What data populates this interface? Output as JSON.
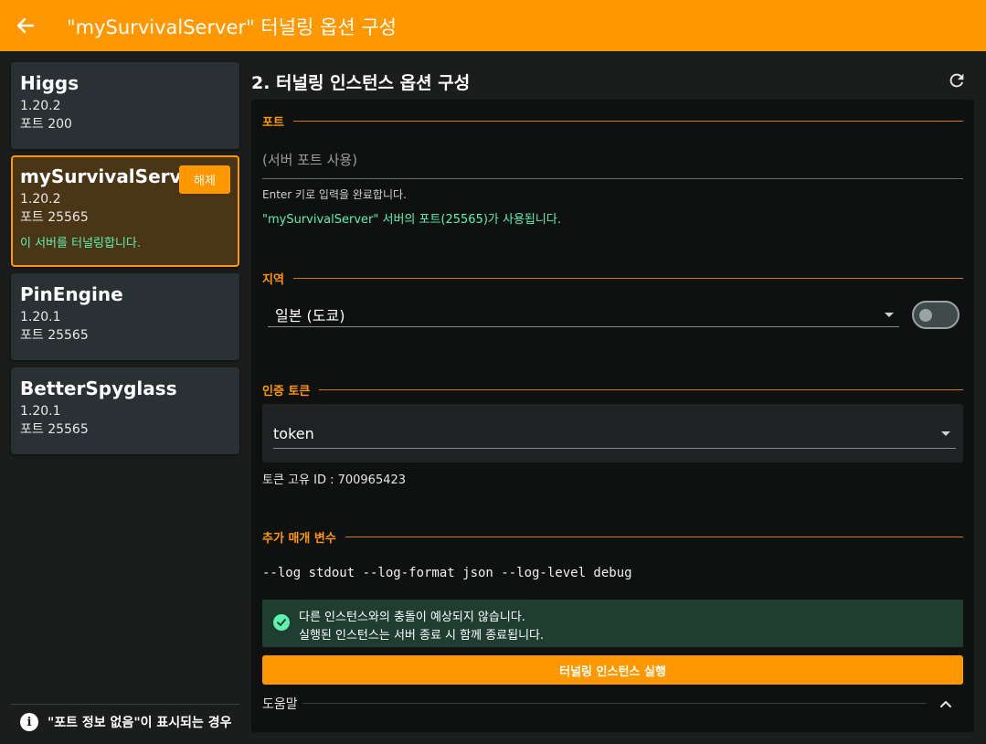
{
  "header": {
    "title": "\"mySurvivalServer\" 터널링 옵션 구성"
  },
  "servers": [
    {
      "name": "Higgs",
      "version": "1.20.2",
      "port": "포트 200"
    },
    {
      "name": "mySurvivalServer",
      "version": "1.20.2",
      "port": "포트 25565",
      "unlink_label": "해제",
      "note": "이 서버를 터널링합니다."
    },
    {
      "name": "PinEngine",
      "version": "1.20.1",
      "port": "포트 25565"
    },
    {
      "name": "BetterSpyglass",
      "version": "1.20.1",
      "port": "포트 25565"
    }
  ],
  "sidebar_help": "\"포트 정보 없음\"이 표시되는 경우",
  "main": {
    "title": "2. 터널링 인스턴스 옵션 구성",
    "port_section": {
      "label": "포트",
      "placeholder": "(서버 포트 사용)",
      "hint": "Enter 키로 입력을 완료합니다.",
      "success": "\"mySurvivalServer\" 서버의 포트(25565)가 사용됩니다."
    },
    "region_section": {
      "label": "지역",
      "selected": "일본 (도쿄)",
      "toggle_on": false
    },
    "token_section": {
      "label": "인증 토큰",
      "selected": "token",
      "token_id": "토큰 고유 ID : 700965423"
    },
    "params_section": {
      "label": "추가 매개 변수",
      "value": "--log stdout --log-format json --log-level debug"
    },
    "alert": {
      "line1": "다른 인스턴스와의 충돌이 예상되지 않습니다.",
      "line2": "실행된 인스턴스는 서버 종료 시 함께 종료됩니다."
    },
    "run_label": "터널링 인스턴스 실행",
    "help_label": "도움말"
  },
  "colors": {
    "accent": "#ff9800",
    "success": "#5df2b0",
    "background": "#1b1d1d",
    "card": "#2a3134"
  }
}
